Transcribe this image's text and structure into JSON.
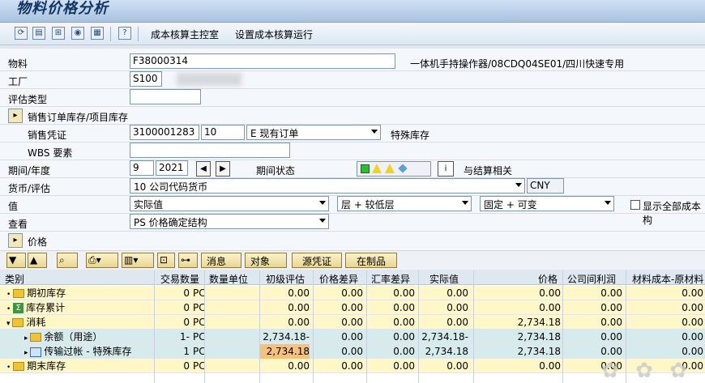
{
  "window": {
    "title": "物料价格分析"
  },
  "toolbar": {
    "icons": [
      "refresh-icon",
      "layout-icon",
      "hierarchy-icon",
      "display-icon",
      "calendar-icon",
      "help-icon"
    ],
    "cost_cockpit": "成本核算主控室",
    "set_cost_run": "设置成本核算运行"
  },
  "form": {
    "material_label": "物料",
    "material_value": "F38000314",
    "material_desc": "一体机手持操作器/08CDQ04SE01/四川快速专用",
    "plant_label": "工厂",
    "plant_value": "S100",
    "valuation_type_label": "评估类型",
    "valuation_type_value": "",
    "sales_order_stock_label": "销售订单库存/项目库存",
    "sales_doc_label": "销售凭证",
    "sales_doc_value": "3100001283",
    "sales_item_value": "10",
    "sales_stock_type": "E 现有订单",
    "special_stock_label": "特殊库存",
    "wbs_label": "WBS 要素",
    "wbs_value": "",
    "period_label": "期间/年度",
    "period_value": "9",
    "year_value": "2021",
    "period_status_label": "期间状态",
    "settlement_label": "与结算相关",
    "currency_label": "货币/评估",
    "currency_type_value": "10 公司代码货币",
    "currency_value": "CNY",
    "value_label": "值",
    "value_select": "实际值",
    "level_select": "层 + 较低层",
    "fixed_select": "固定 + 可变",
    "show_all_label": "显示全部成本构",
    "view_label": "查看",
    "view_select": "PS 价格确定结构",
    "price_label": "价格"
  },
  "grid_toolbar": {
    "message_label": "消息",
    "object_label": "对象",
    "source_doc_label": "源凭证",
    "wip_label": "在制品"
  },
  "table": {
    "headers": [
      "类别",
      "交易数量",
      "数量单位",
      "初级评估",
      "价格差异",
      "汇率差异",
      "实际值",
      "价格",
      "公司间利润",
      "材料成本-原材料"
    ],
    "rows": [
      {
        "category": "期初库存",
        "qty": "0",
        "unit": "PC",
        "primary": "0.00",
        "price_var": "0.00",
        "fx_var": "0.00",
        "actual": "0.00",
        "price": "0.00",
        "interco": "0.00",
        "material": "0.00"
      },
      {
        "category": "库存累计",
        "qty": "0",
        "unit": "PC",
        "primary": "0.00",
        "price_var": "0.00",
        "fx_var": "0.00",
        "actual": "0.00",
        "price": "0.00",
        "interco": "0.00",
        "material": "0.00"
      },
      {
        "category": "消耗",
        "qty": "0",
        "unit": "PC",
        "primary": "0.00",
        "price_var": "0.00",
        "fx_var": "0.00",
        "actual": "0.00",
        "price": "2,734.18",
        "interco": "0.00",
        "material": "0.00"
      },
      {
        "category": "余额（用途）",
        "qty": "1-",
        "unit": "PC",
        "primary": "2,734.18-",
        "price_var": "0.00",
        "fx_var": "0.00",
        "actual": "2,734.18-",
        "price": "2,734.18",
        "interco": "0.00",
        "material": "0.00"
      },
      {
        "category": "传输过帐 - 特殊库存",
        "qty": "1",
        "unit": "PC",
        "primary": "2,734.18",
        "price_var": "0.00",
        "fx_var": "0.00",
        "actual": "2,734.18",
        "price": "2,734.18",
        "interco": "0.00",
        "material": "0.00"
      },
      {
        "category": "期末库存",
        "qty": "0",
        "unit": "PC",
        "primary": "0.00",
        "price_var": "0.00",
        "fx_var": "0.00",
        "actual": "0.00",
        "price": "0.00",
        "interco": "0.00",
        "material": "0.00"
      }
    ]
  },
  "colors": {
    "yellow_row": "#fff8c6",
    "teal_row": "#d6ecec",
    "orange_cell": "#f6c27a"
  }
}
